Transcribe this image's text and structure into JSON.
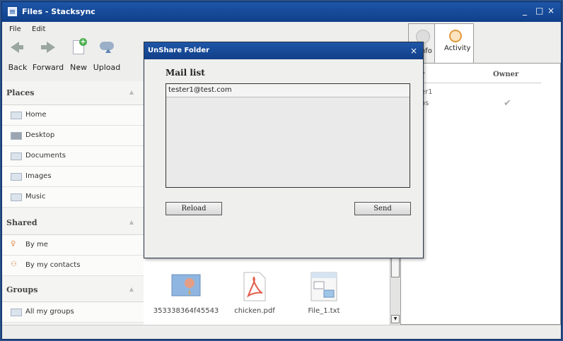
{
  "window": {
    "title": "Files - Stacksync",
    "controls": [
      "_",
      "□",
      "×"
    ]
  },
  "menu": {
    "items": [
      "File",
      "Edit"
    ]
  },
  "toolbar": {
    "back": "Back",
    "forward": "Forward",
    "new": "New",
    "upload": "Upload"
  },
  "sidebar": {
    "places": {
      "title": "Places",
      "items": [
        "Home",
        "Desktop",
        "Documents",
        "Images",
        "Music"
      ]
    },
    "shared": {
      "title": "Shared",
      "items": [
        "By me",
        "By my contacts"
      ]
    },
    "groups": {
      "title": "Groups",
      "items": [
        "All my groups"
      ]
    }
  },
  "files": [
    {
      "name": "353338364f45543",
      "icon": "image-file-icon"
    },
    {
      "name": "chicken.pdf",
      "icon": "pdf-file-icon"
    },
    {
      "name": "File_1.txt",
      "icon": "text-file-icon"
    }
  ],
  "tabs": {
    "info": "Info",
    "activity": "Activity"
  },
  "right_panel": {
    "col_user": "r",
    "col_owner": "Owner",
    "rows": [
      "er1",
      "os"
    ]
  },
  "dialog": {
    "title": "UnShare Folder",
    "close": "×",
    "mail_list_label": "Mail list",
    "mail_list": [
      "tester1@test.com"
    ],
    "reload": "Reload",
    "send": "Send"
  },
  "colors": {
    "titlebar": "#1e56a8",
    "accent_pdf": "#e35c4a"
  }
}
